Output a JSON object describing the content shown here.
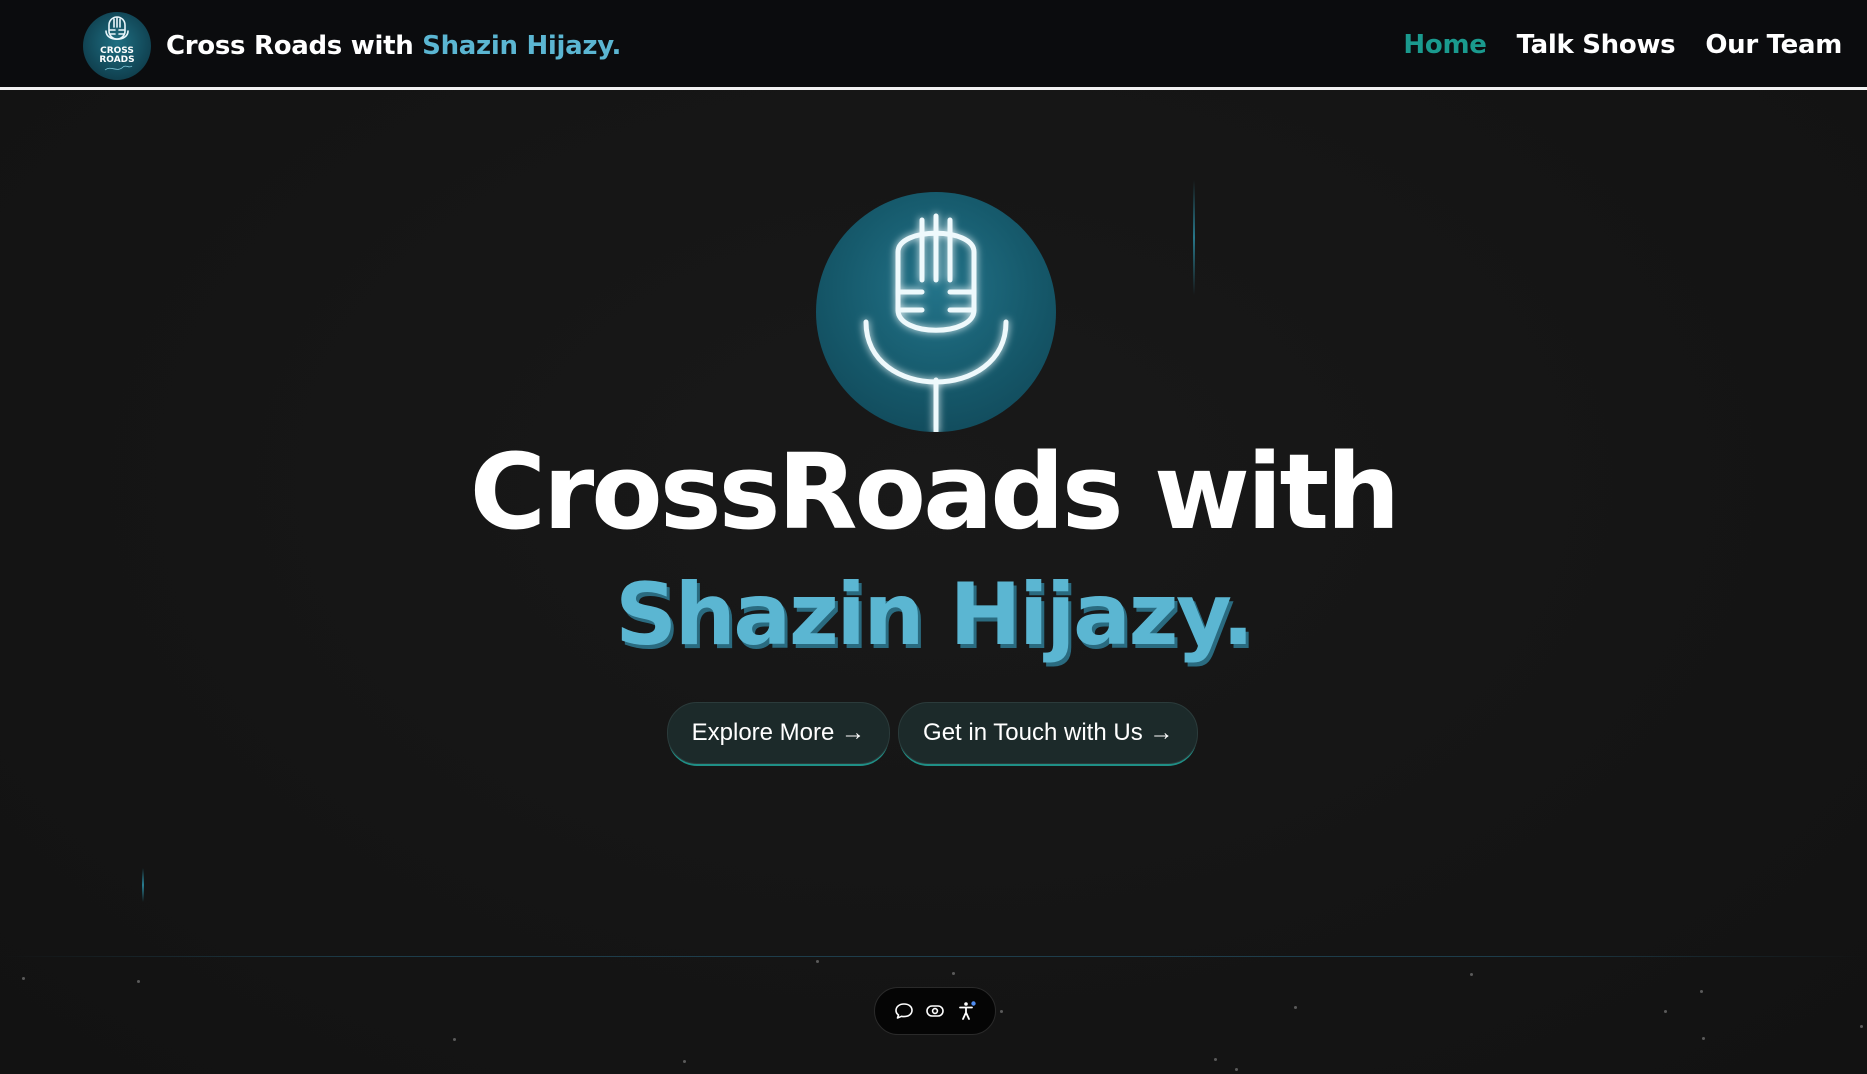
{
  "brand": {
    "logo_text_line1": "CROSS",
    "logo_text_line2": "ROADS",
    "title_prefix": "Cross Roads with ",
    "title_accent": "Shazin Hijazy."
  },
  "nav": {
    "items": [
      {
        "label": "Home",
        "active": true
      },
      {
        "label": "Talk Shows",
        "active": false
      },
      {
        "label": "Our Team",
        "active": false
      }
    ]
  },
  "hero": {
    "icon": "microphone-icon",
    "title_line1": "CrossRoads with",
    "title_line2": "Shazin Hijazy.",
    "buttons": [
      {
        "label": "Explore More →"
      },
      {
        "label": "Get in Touch with Us →"
      }
    ]
  },
  "accessibility_toolbar": {
    "icons": [
      "chat-bubble-icon",
      "eye-icon",
      "accessibility-person-icon"
    ]
  },
  "colors": {
    "background": "#141414",
    "navbar": "#0b0c0e",
    "accent_blue": "#5bb6d2",
    "active_teal": "#1a9a8e",
    "mic_circle": "#165a6c",
    "button_bg": "#1c2a2a"
  }
}
